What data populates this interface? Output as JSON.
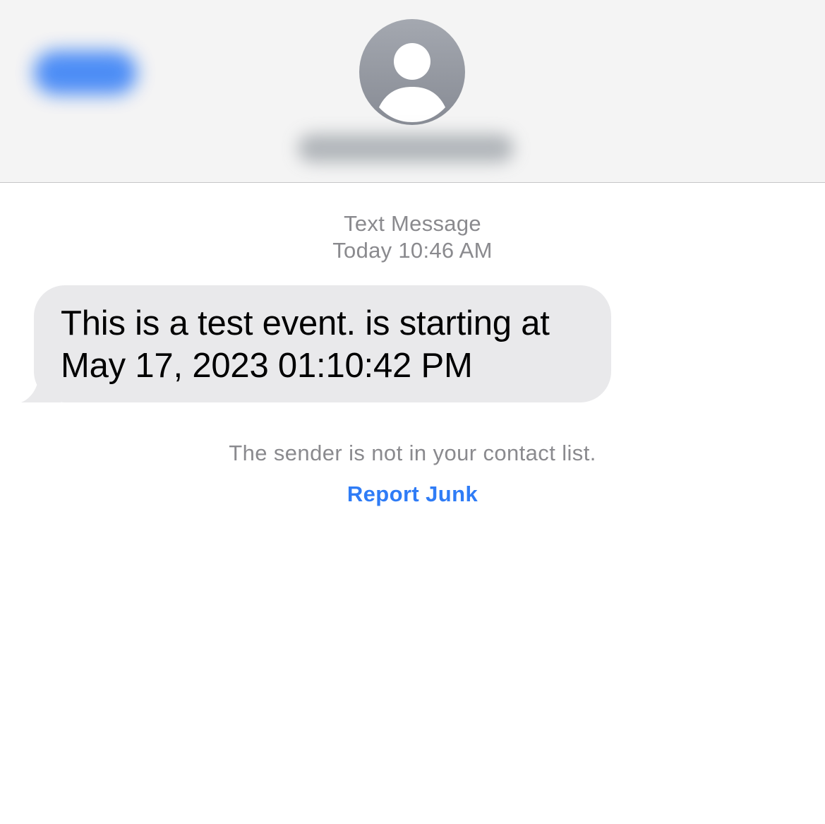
{
  "header": {
    "back_button_blurred": "",
    "contact_name_blurred": "",
    "avatar_icon": "person-silhouette-icon"
  },
  "conversation": {
    "message_kind": "Text Message",
    "timestamp": "Today 10:46 AM",
    "messages": [
      {
        "direction": "incoming",
        "text_line_1": "This is a test event. is starting at",
        "text_line_2": "May 17, 2023 01:10:42 PM"
      }
    ],
    "notice": "The sender is not in your contact list.",
    "report_junk_label": "Report Junk"
  },
  "colors": {
    "header_bg": "#f4f4f4",
    "incoming_bubble": "#e9e9eb",
    "secondary_text": "#8a8a8e",
    "link": "#2f7cf6",
    "avatar": "#9a9ea6"
  }
}
